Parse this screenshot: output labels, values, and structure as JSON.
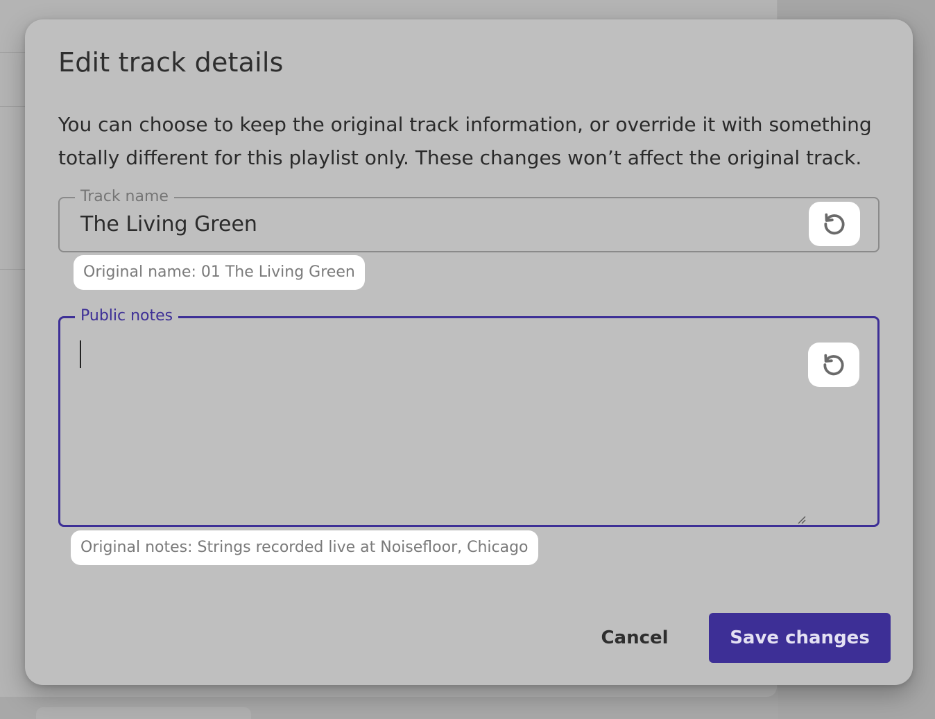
{
  "dialog": {
    "title": "Edit track details",
    "description": "You can choose to keep the original track information, or override it with something totally different for this playlist only. These changes won’t affect the original track."
  },
  "track_name": {
    "label": "Track name",
    "value": "The Living Green",
    "hint": "Original name: 01 The Living Green",
    "reset_icon": "undo-icon"
  },
  "public_notes": {
    "label": "Public notes",
    "value": "",
    "hint": "Original notes: Strings recorded live at Noisefloor, Chicago",
    "reset_icon": "undo-icon",
    "focused": true
  },
  "actions": {
    "cancel_label": "Cancel",
    "save_label": "Save changes"
  },
  "colors": {
    "accent": "#3d2f96",
    "overlay_dialog": "#bfbfbf",
    "chip_bg": "#ffffff"
  }
}
